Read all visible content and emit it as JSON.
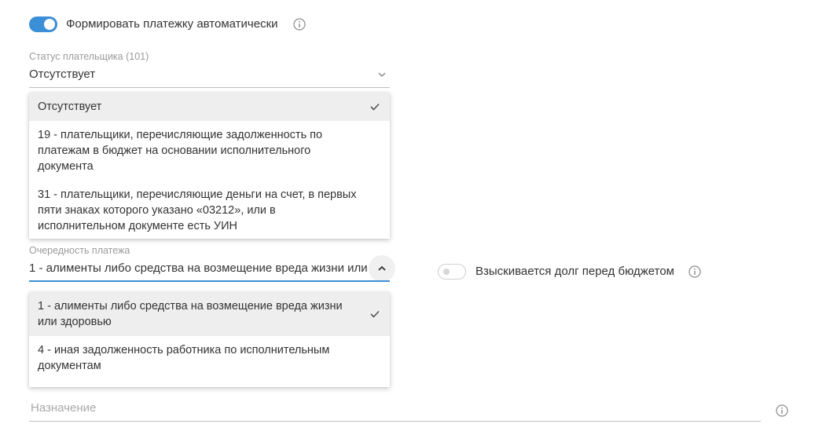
{
  "auto_payment": {
    "label": "Формировать платежку автоматически",
    "enabled": true
  },
  "payer_status": {
    "label": "Статус плательщика (101)",
    "value": "Отсутствует",
    "options": [
      "Отсутствует",
      "19 - плательщики, перечисляющие задолженность по платежам в бюджет на основании исполнительного документа",
      "31 - плательщики, перечисляющие деньги на счет, в первых пяти знаках которого указано «03212», или в исполнительном документе есть УИН"
    ],
    "selected_index": 0
  },
  "payment_order": {
    "label": "Очередность платежа",
    "value": "1 - алименты либо средства на возмещение вреда жизни или здоровью",
    "options": [
      "1 - алименты либо средства на возмещение вреда жизни или здоровью",
      "4 - иная задолженность работника по исполнительным документам"
    ],
    "selected_index": 0
  },
  "budget_debt": {
    "label": "Взыскивается долг перед бюджетом",
    "enabled": false
  },
  "purpose": {
    "placeholder": "Назначение"
  },
  "colors": {
    "accent": "#3b8fd6",
    "text": "#333333",
    "muted": "#9a9a9a",
    "selected_bg": "#eeeeee"
  },
  "icons": {
    "info": "info-circle-icon",
    "check": "check-icon",
    "chevron_down": "chevron-down-icon",
    "chevron_up": "chevron-up-icon"
  }
}
